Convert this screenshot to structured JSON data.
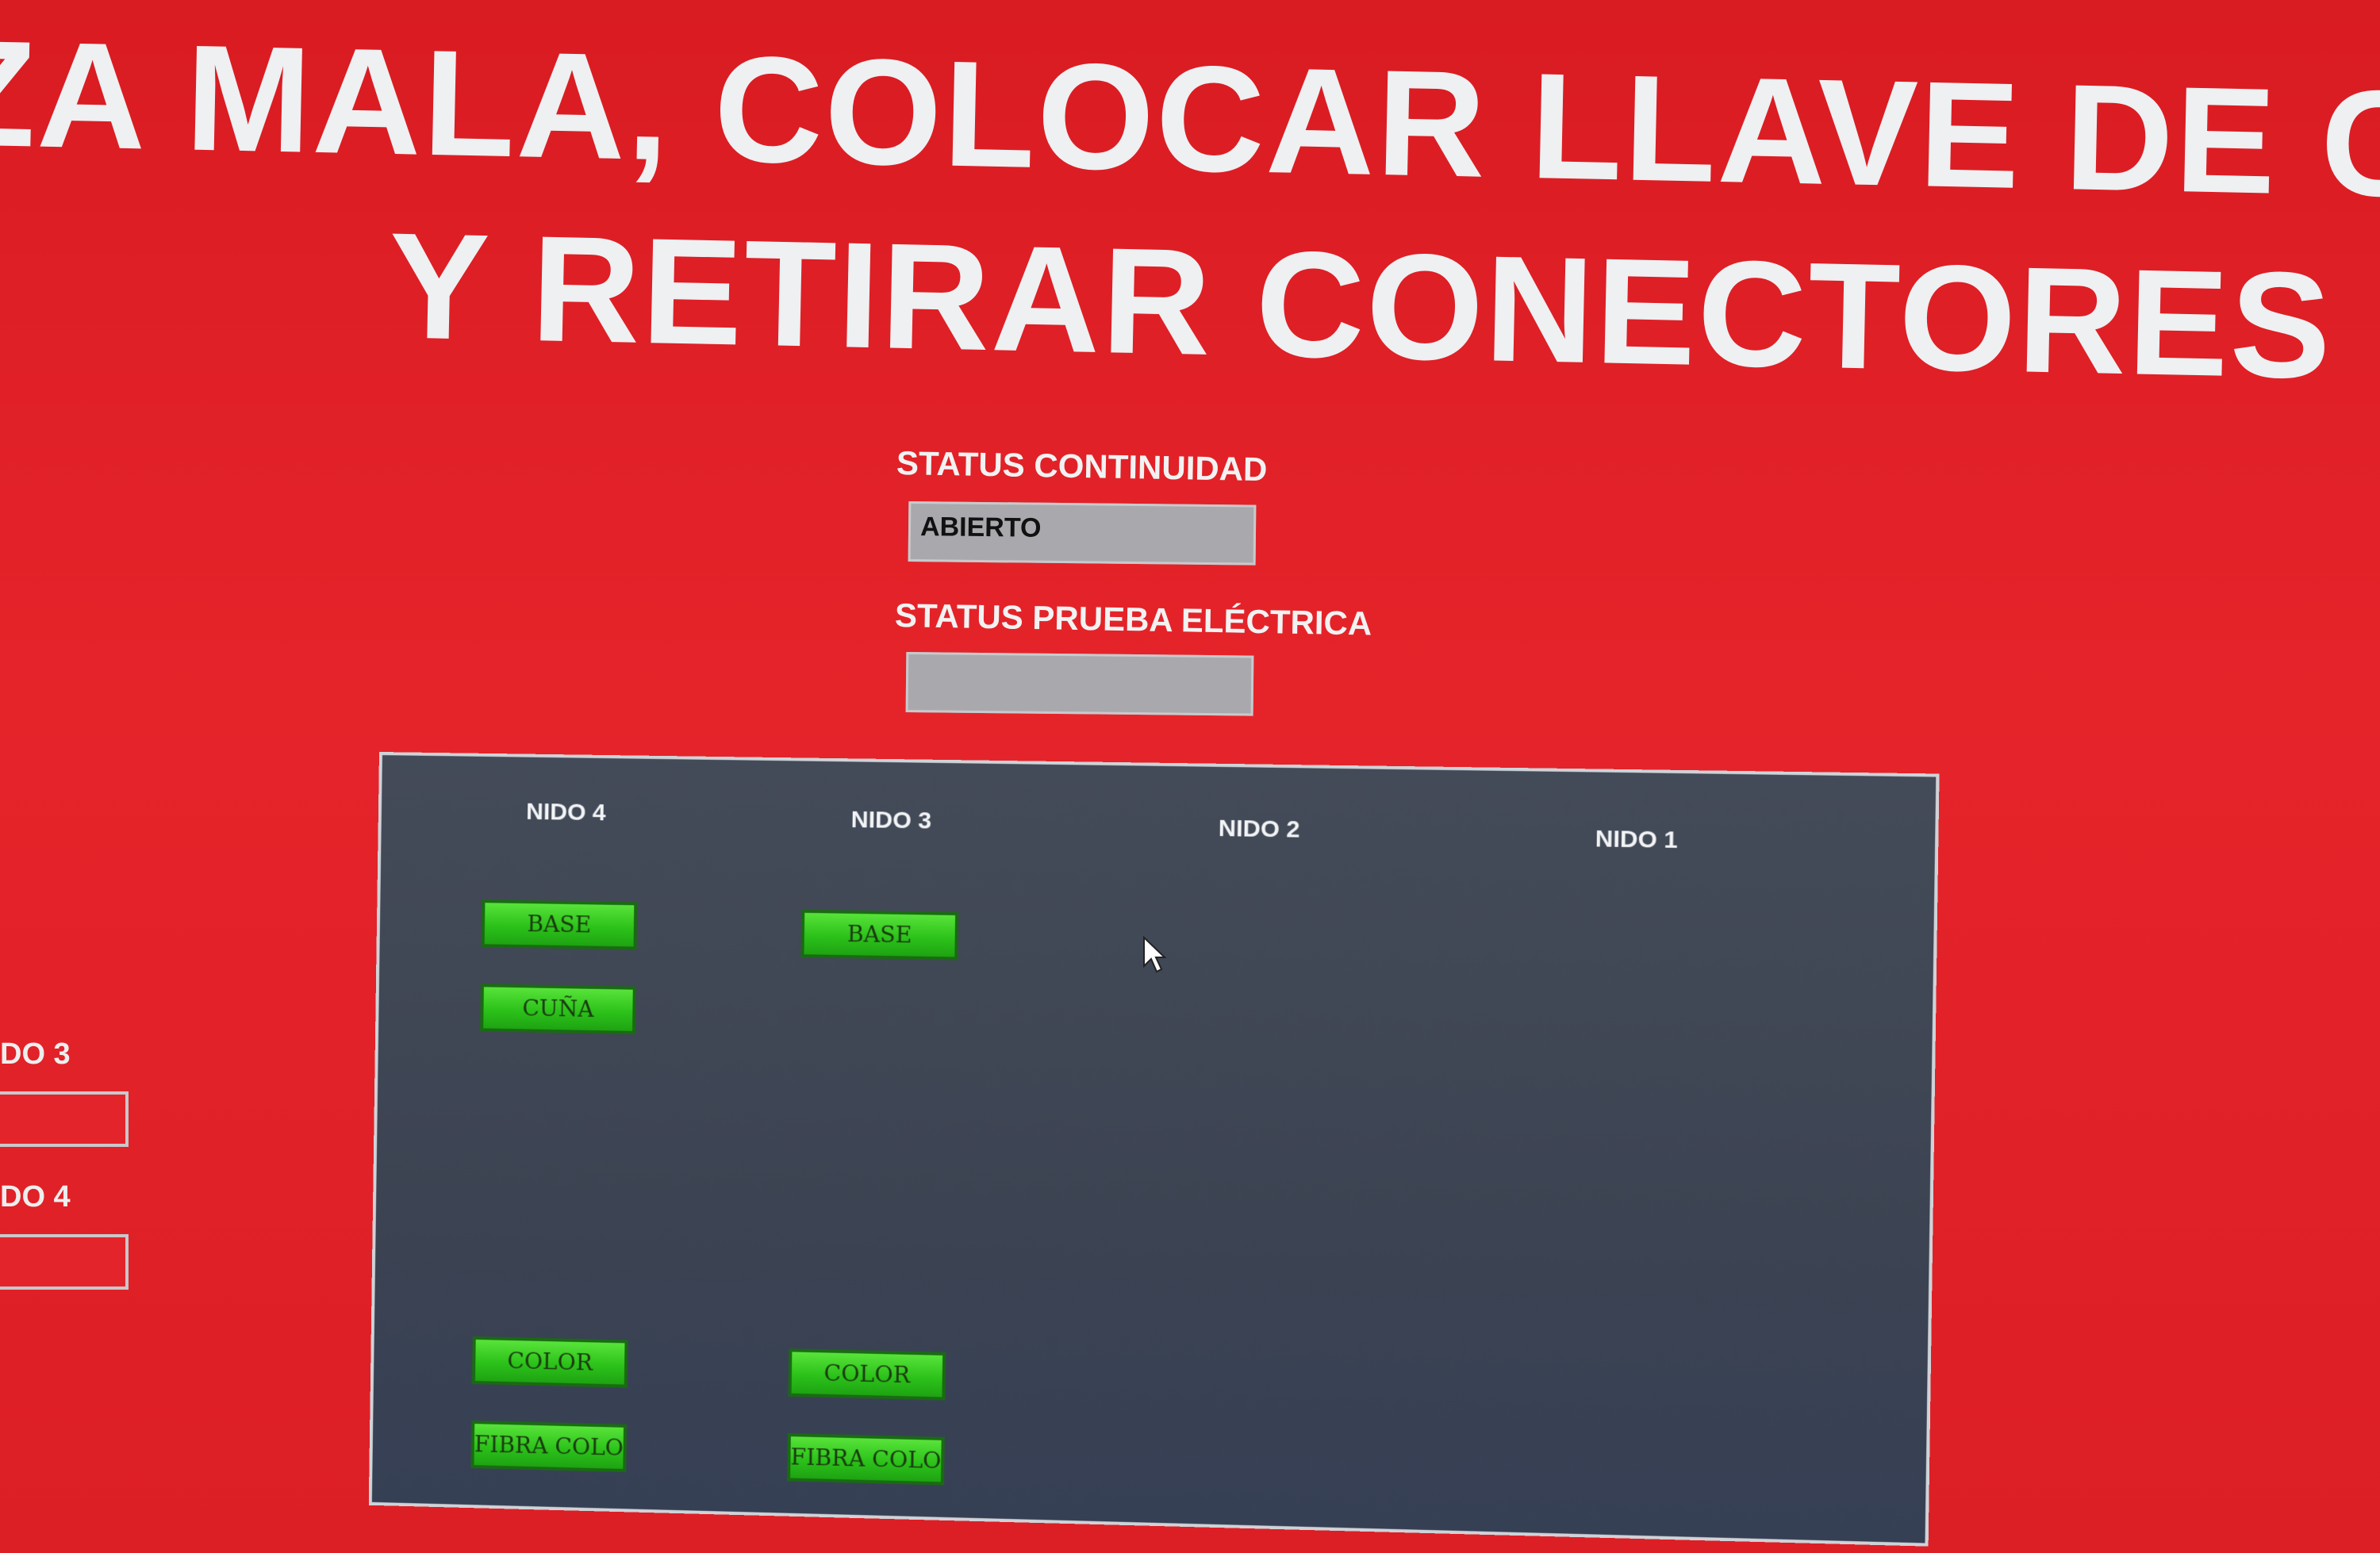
{
  "banner": {
    "line1": "EZA MALA, COLOCAR LLAVE DE  CALIDA",
    "line2": "Y RETIRAR CONECTORES"
  },
  "status": {
    "continuidad_label": "STATUS CONTINUIDAD",
    "continuidad_value": "ABIERTO",
    "prueba_label": "STATUS PRUEBA ELÉCTRICA",
    "prueba_value": ""
  },
  "side_panel": {
    "items": [
      {
        "label": "DO 3"
      },
      {
        "label": "DO 4"
      }
    ]
  },
  "nidos": {
    "headers": [
      "NIDO 4",
      "NIDO 3",
      "NIDO 2",
      "NIDO 1"
    ],
    "nido4": {
      "top": [
        "BASE",
        "CUÑA"
      ],
      "bottom": [
        "COLOR",
        "FIBRA COLOR"
      ]
    },
    "nido3": {
      "top": [
        "BASE"
      ],
      "bottom": [
        "COLOR",
        "FIBRA COLOR"
      ]
    }
  },
  "colors": {
    "background": "#e02024",
    "panel": "#3c4352",
    "indicator_on": "#2cc21a",
    "status_field": "#a9a9ad"
  },
  "icons": {
    "cursor": "mouse-pointer-icon"
  }
}
